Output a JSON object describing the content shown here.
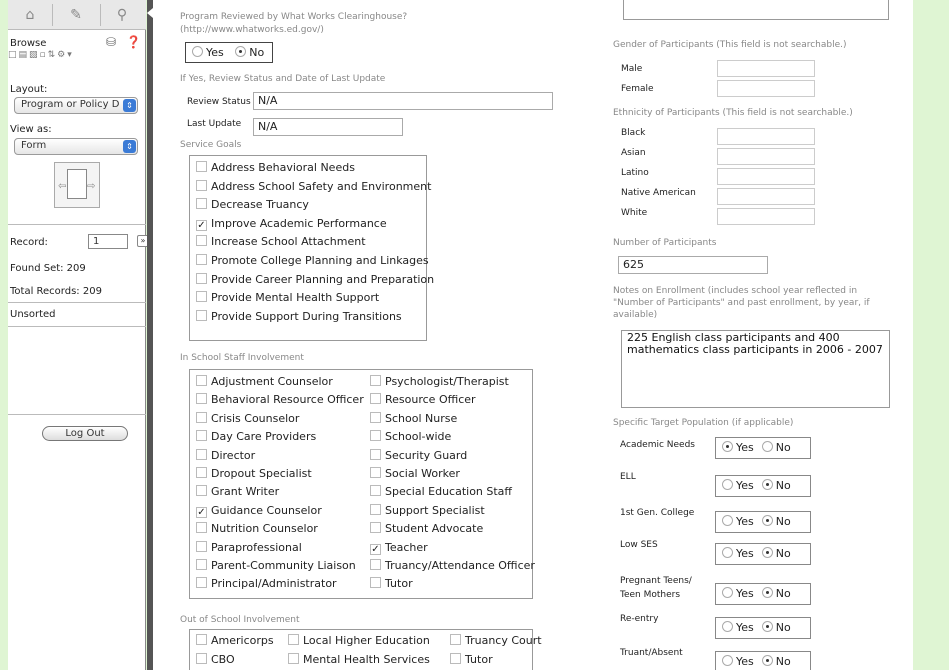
{
  "sidebar": {
    "browse_label": "Browse",
    "layout_label": "Layout:",
    "layout_value": "Program or Policy D",
    "view_as_label": "View as:",
    "view_as_value": "Form",
    "record_label": "Record:",
    "record_value": "1",
    "found_set": "Found Set: 209",
    "total_records": "Total Records: 209",
    "sort_status": "Unsorted",
    "logout_label": "Log Out"
  },
  "form": {
    "wwc_question": "Program Reviewed by What Works Clearinghouse?",
    "wwc_url": "(http://www.whatworks.ed.gov/)",
    "wwc_yes": "Yes",
    "wwc_no": "No",
    "wwc_selected": "No",
    "review_header": "If Yes, Review Status and Date of Last Update",
    "review_status_label": "Review Status",
    "review_status_value": "N/A",
    "last_update_label": "Last Update",
    "last_update_value": "N/A",
    "service_goals_label": "Service Goals",
    "service_goals": [
      {
        "label": "Address Behavioral Needs",
        "checked": false
      },
      {
        "label": "Address School Safety and Environment",
        "checked": false
      },
      {
        "label": "Decrease Truancy",
        "checked": false
      },
      {
        "label": "Improve Academic Performance",
        "checked": true
      },
      {
        "label": "Increase School Attachment",
        "checked": false
      },
      {
        "label": "Promote College Planning and Linkages",
        "checked": false
      },
      {
        "label": "Provide Career Planning and Preparation",
        "checked": false
      },
      {
        "label": "Provide Mental Health Support",
        "checked": false
      },
      {
        "label": "Provide Support During Transitions",
        "checked": false
      }
    ],
    "staff_label": "In School Staff Involvement",
    "staff_left": [
      {
        "label": "Adjustment Counselor",
        "checked": false
      },
      {
        "label": "Behavioral Resource Officer",
        "checked": false
      },
      {
        "label": "Crisis Counselor",
        "checked": false
      },
      {
        "label": "Day Care Providers",
        "checked": false
      },
      {
        "label": "Director",
        "checked": false
      },
      {
        "label": "Dropout Specialist",
        "checked": false
      },
      {
        "label": "Grant Writer",
        "checked": false
      },
      {
        "label": "Guidance Counselor",
        "checked": true
      },
      {
        "label": "Nutrition Counselor",
        "checked": false
      },
      {
        "label": "Paraprofessional",
        "checked": false
      },
      {
        "label": "Parent-Community Liaison",
        "checked": false
      },
      {
        "label": "Principal/Administrator",
        "checked": false
      }
    ],
    "staff_right": [
      {
        "label": "Psychologist/Therapist",
        "checked": false
      },
      {
        "label": "Resource Officer",
        "checked": false
      },
      {
        "label": "School Nurse",
        "checked": false
      },
      {
        "label": "School-wide",
        "checked": false
      },
      {
        "label": "Security Guard",
        "checked": false
      },
      {
        "label": "Social Worker",
        "checked": false
      },
      {
        "label": "Special Education Staff",
        "checked": false
      },
      {
        "label": "Support Specialist",
        "checked": false
      },
      {
        "label": "Student Advocate",
        "checked": false
      },
      {
        "label": "Teacher",
        "checked": true
      },
      {
        "label": "Truancy/Attendance Officer",
        "checked": false
      },
      {
        "label": "Tutor",
        "checked": false
      }
    ],
    "out_of_school_label": "Out of School Involvement",
    "out_of_school": [
      [
        "Americorps",
        "Local Higher Education",
        "Truancy Court"
      ],
      [
        "CBO",
        "Mental Health Services",
        "Tutor"
      ]
    ],
    "gender_label": "Gender of Participants (This field is not searchable.)",
    "gender_rows": [
      "Male",
      "Female"
    ],
    "ethnicity_label": "Ethnicity of Participants (This field is not searchable.)",
    "ethnicity_rows": [
      "Black",
      "Asian",
      "Latino",
      "Native American",
      "White"
    ],
    "num_participants_label": "Number of Participants",
    "num_participants_value": "625",
    "enrollment_notes_label_1": "Notes on Enrollment (includes school year reflected in",
    "enrollment_notes_label_2": "\"Number of Participants\" and past enrollment, by year, if",
    "enrollment_notes_label_3": "available)",
    "enrollment_notes_1": "225 English class participants and 400",
    "enrollment_notes_2": "mathematics class participants in 2006 - 2007",
    "target_pop_label": "Specific Target Population (if applicable)",
    "target_pop": [
      {
        "label": "Academic Needs",
        "selected": "Yes"
      },
      {
        "label": "ELL",
        "selected": "No"
      },
      {
        "label": "1st Gen. College",
        "selected": "No"
      },
      {
        "label": "Low SES",
        "selected": "No"
      },
      {
        "label": "Pregnant Teens/ Teen Mothers",
        "selected": "No"
      },
      {
        "label": "Re-entry",
        "selected": "No"
      },
      {
        "label": "Truant/Absent",
        "selected": "No"
      }
    ],
    "yes_label": "Yes",
    "no_label": "No"
  }
}
